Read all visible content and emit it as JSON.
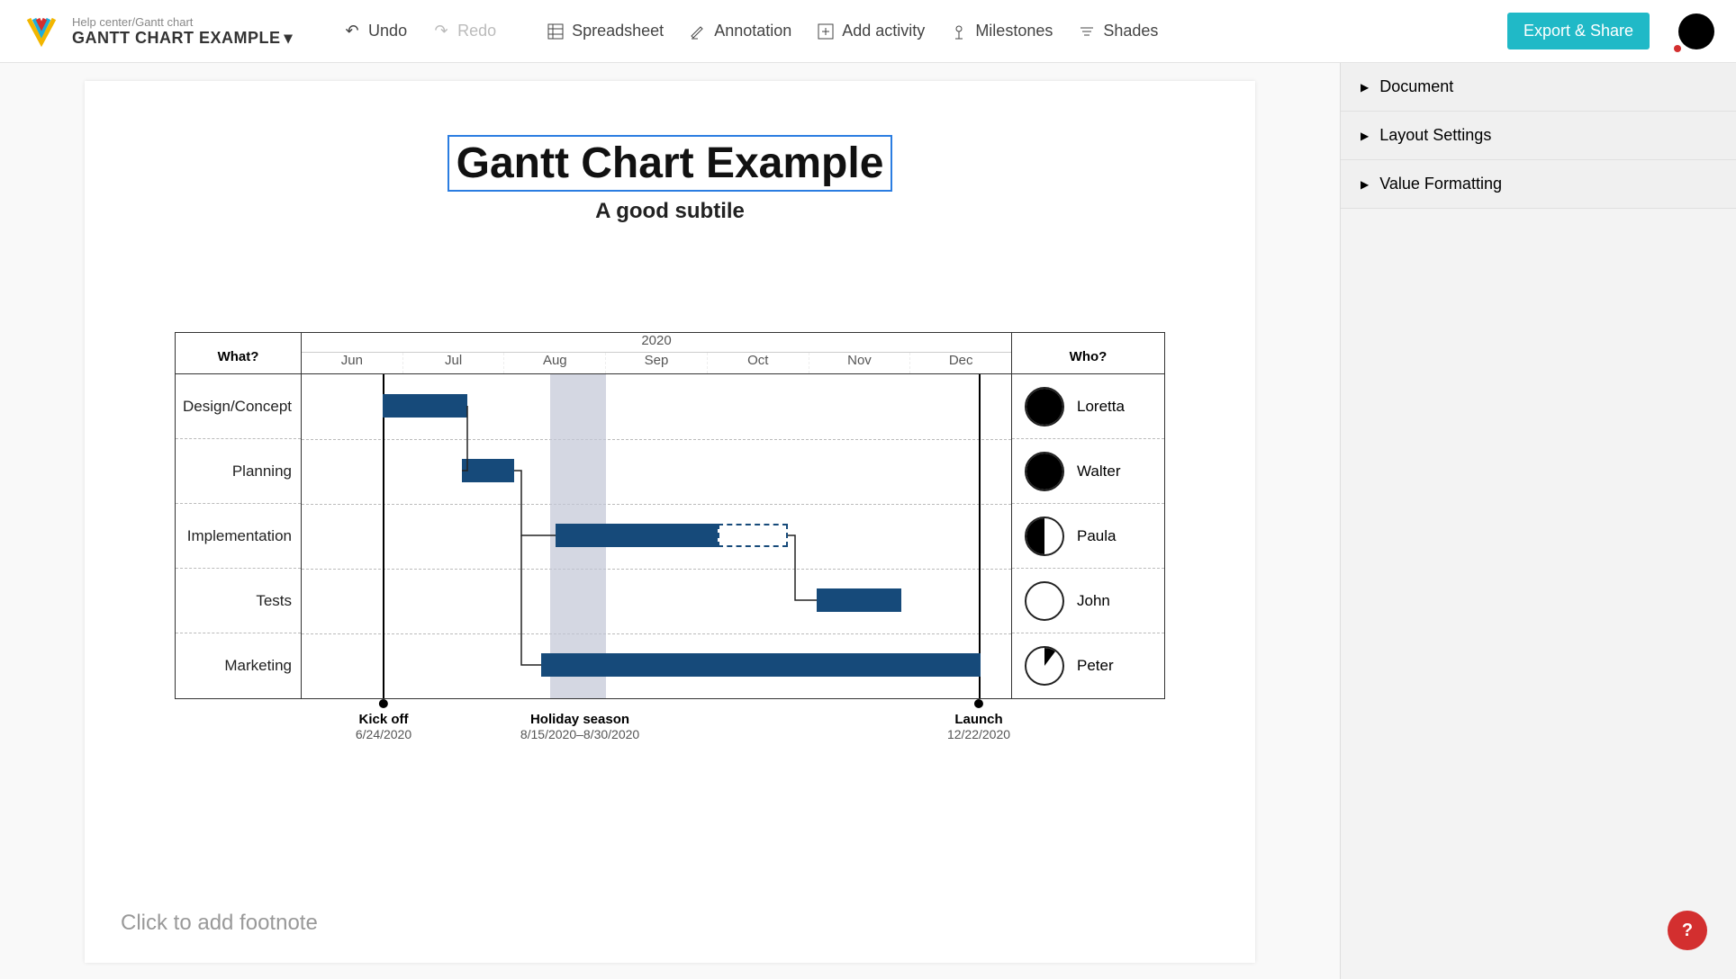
{
  "breadcrumb": "Help center/Gantt chart",
  "doc_title": "GANTT CHART EXAMPLE",
  "toolbar": {
    "undo": "Undo",
    "redo": "Redo",
    "spreadsheet": "Spreadsheet",
    "annotation": "Annotation",
    "add_activity": "Add activity",
    "milestones": "Milestones",
    "shades": "Shades"
  },
  "export_label": "Export & Share",
  "sidepanel": {
    "document": "Document",
    "layout": "Layout Settings",
    "value_fmt": "Value Formatting"
  },
  "chart": {
    "title": "Gantt Chart Example",
    "subtitle": "A good subtile",
    "what_header": "What?",
    "who_header": "Who?",
    "year": "2020",
    "months": [
      "Jun",
      "Jul",
      "Aug",
      "Sep",
      "Oct",
      "Nov",
      "Dec"
    ],
    "tasks": [
      {
        "name": "Design/Concept",
        "who": "Loretta",
        "alloc": 1.0
      },
      {
        "name": "Planning",
        "who": "Walter",
        "alloc": 1.0
      },
      {
        "name": "Implementation",
        "who": "Paula",
        "alloc": 0.5
      },
      {
        "name": "Tests",
        "who": "John",
        "alloc": 0.0
      },
      {
        "name": "Marketing",
        "who": "Peter",
        "alloc": 0.15
      }
    ],
    "milestones": [
      {
        "label": "Kick off",
        "date": "6/24/2020"
      },
      {
        "label": "Holiday season",
        "date": "8/15/2020–8/30/2020"
      },
      {
        "label": "Launch",
        "date": "12/22/2020"
      }
    ]
  },
  "footnote_placeholder": "Click to add footnote",
  "help_label": "?",
  "chart_data": {
    "type": "bar",
    "title": "Gantt Chart Example",
    "subtitle": "A good subtile",
    "xlabel": "2020",
    "x_categories": [
      "Jun",
      "Jul",
      "Aug",
      "Sep",
      "Oct",
      "Nov",
      "Dec"
    ],
    "series": [
      {
        "name": "Design/Concept",
        "start": "2020-06-24",
        "end": "2020-07-15",
        "assignee": "Loretta",
        "allocation": 1.0
      },
      {
        "name": "Planning",
        "start": "2020-07-15",
        "end": "2020-08-05",
        "assignee": "Walter",
        "allocation": 1.0
      },
      {
        "name": "Implementation",
        "start": "2020-08-15",
        "end": "2020-09-30",
        "planned_end": "2020-10-20",
        "assignee": "Paula",
        "allocation": 0.5
      },
      {
        "name": "Tests",
        "start": "2020-11-01",
        "end": "2020-11-25",
        "assignee": "John",
        "allocation": 0.0
      },
      {
        "name": "Marketing",
        "start": "2020-08-10",
        "end": "2020-12-22",
        "assignee": "Peter",
        "allocation": 0.15
      }
    ],
    "shades": [
      {
        "label": "Holiday season",
        "start": "2020-08-15",
        "end": "2020-08-30"
      }
    ],
    "milestones": [
      {
        "label": "Kick off",
        "date": "2020-06-24"
      },
      {
        "label": "Launch",
        "date": "2020-12-22"
      }
    ],
    "xlim": [
      "2020-06-01",
      "2020-12-31"
    ]
  }
}
